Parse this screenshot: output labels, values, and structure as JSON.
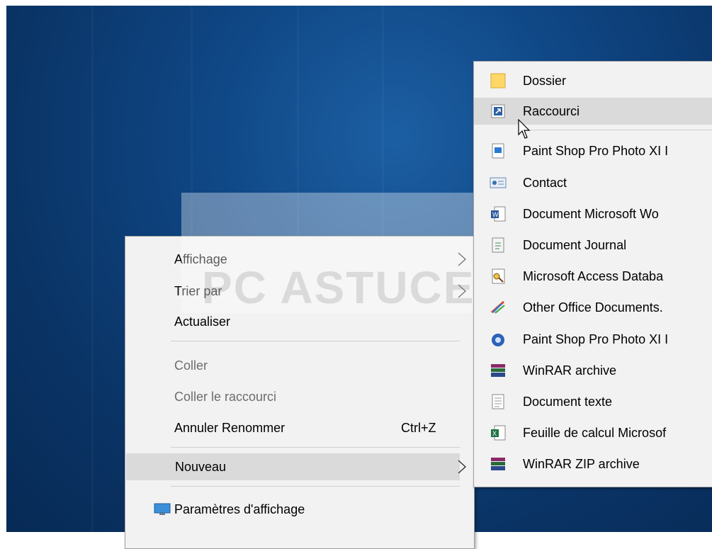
{
  "context_menu": {
    "items": [
      {
        "label": "Affichage",
        "submenu": true
      },
      {
        "label": "Trier par",
        "submenu": true
      },
      {
        "label": "Actualiser"
      },
      {
        "label": "Coller",
        "disabled": true
      },
      {
        "label": "Coller le raccourci",
        "disabled": true
      },
      {
        "label": "Annuler Renommer",
        "shortcut": "Ctrl+Z"
      },
      {
        "label": "Nouveau",
        "submenu": true,
        "highlighted": true
      },
      {
        "label": "Paramètres d'affichage",
        "icon": "display-settings-icon"
      }
    ]
  },
  "new_submenu": {
    "items": [
      {
        "label": "Dossier",
        "icon": "folder-icon"
      },
      {
        "label": "Raccourci",
        "icon": "shortcut-icon",
        "highlighted": true
      },
      {
        "label": "Paint Shop Pro Photo XI I",
        "icon": "psp-image-icon"
      },
      {
        "label": "Contact",
        "icon": "contact-card-icon"
      },
      {
        "label": "Document Microsoft Wo",
        "icon": "word-document-icon"
      },
      {
        "label": "Document Journal",
        "icon": "journal-icon"
      },
      {
        "label": "Microsoft Access Databa",
        "icon": "access-database-icon"
      },
      {
        "label": "Other Office Documents.",
        "icon": "office-documents-icon"
      },
      {
        "label": "Paint Shop Pro Photo XI I",
        "icon": "psp-app-icon"
      },
      {
        "label": "WinRAR archive",
        "icon": "winrar-icon"
      },
      {
        "label": "Document texte",
        "icon": "text-document-icon"
      },
      {
        "label": "Feuille de calcul Microsof",
        "icon": "excel-sheet-icon"
      },
      {
        "label": "WinRAR ZIP archive",
        "icon": "winrar-zip-icon"
      }
    ]
  },
  "watermark": {
    "text": "PC ASTUCES"
  },
  "colors": {
    "desktop": "#0f4684",
    "menu_bg": "#f2f2f2",
    "highlight": "#dadada",
    "disabled_text": "#6d6d6d"
  }
}
